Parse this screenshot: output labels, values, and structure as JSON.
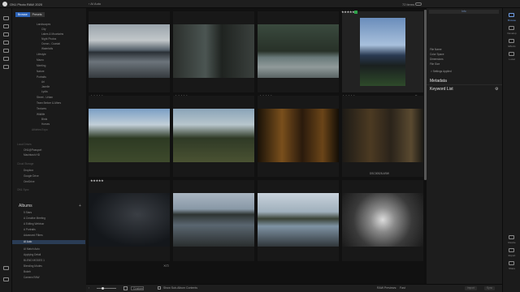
{
  "app": {
    "title": "ON1 Photo RAW 2020",
    "back_label": "AI Auto",
    "item_count": "72 items"
  },
  "sidebar": {
    "tabs": [
      {
        "label": "Browse"
      },
      {
        "label": "Presets"
      }
    ],
    "tree": [
      {
        "label": "Landscapes"
      },
      {
        "label": "City"
      },
      {
        "label": "Lakes & Mountains"
      },
      {
        "label": "Night Photos"
      },
      {
        "label": "Ocean - Coastal"
      },
      {
        "label": "Waterfalls"
      },
      {
        "label": "Lifestyle"
      },
      {
        "label": "Macro"
      },
      {
        "label": "Meeting"
      },
      {
        "label": "Nature"
      },
      {
        "label": "Portraits"
      },
      {
        "label": "Ari"
      },
      {
        "label": "Janelle"
      },
      {
        "label": "Lydia"
      },
      {
        "label": "Street - Urban"
      },
      {
        "label": "Team Before & Afters"
      },
      {
        "label": "Textures"
      },
      {
        "label": "Wildlife"
      },
      {
        "label": "Birds"
      },
      {
        "label": "Horses"
      },
      {
        "label": "Athletes Expo"
      }
    ],
    "local_drives": {
      "label": "Local Drives",
      "items": [
        {
          "label": "ON1@Passport"
        },
        {
          "label": "Macintosh HD"
        }
      ]
    },
    "cloud_storage": {
      "label": "Cloud Storage",
      "items": [
        {
          "label": "Dropbox"
        },
        {
          "label": "Google Drive"
        },
        {
          "label": "OneDrive"
        }
      ]
    },
    "on1_sync": {
      "label": "ON1 Sync"
    },
    "albums": {
      "title": "Albums",
      "add": "+",
      "items": [
        {
          "label": "5 Stars"
        },
        {
          "label": "A Creative Meeting"
        },
        {
          "label": "A Editing Webinar"
        },
        {
          "label": "A Portraits"
        },
        {
          "label": "Advanced Filters"
        },
        {
          "label": "AI Auto"
        },
        {
          "label": "AI Match Auto"
        },
        {
          "label": "Applying Detail"
        },
        {
          "label": "BLEND MODES 1"
        },
        {
          "label": "Blending Modes"
        },
        {
          "label": "Bokeh"
        },
        {
          "label": "Camera RAW"
        }
      ]
    }
  },
  "grid": {
    "cells": [
      {
        "stars": "★★★★★",
        "filename": "",
        "badge": false
      },
      {
        "stars": "★★★★★",
        "filename": "",
        "badge": false
      },
      {
        "stars": "★★★★★",
        "filename": "",
        "badge": false
      },
      {
        "stars": "★★★★★",
        "filename": "",
        "badge": true
      },
      {
        "stars": "★★★★★",
        "filename": "",
        "badge": false
      },
      {
        "stars": "",
        "filename": "",
        "badge": false
      },
      {
        "stars": "",
        "filename": "",
        "badge": false
      },
      {
        "stars": "",
        "filename": "DSC00528.ARW",
        "badge": false
      },
      {
        "stars": "★★★★★",
        "filename": "",
        "badge": false
      },
      {
        "stars": "",
        "filename": "",
        "badge": false
      },
      {
        "stars": "",
        "filename": "",
        "badge": false
      },
      {
        "stars": "",
        "filename": "",
        "badge": false
      }
    ]
  },
  "info_panel": {
    "header_tab": "Info",
    "fields": [
      {
        "label": "File Name"
      },
      {
        "label": "Color Space"
      },
      {
        "label": "Dimensions"
      },
      {
        "label": "File Size"
      }
    ],
    "settings_applied": "> Settings Applied",
    "metadata_title": "Metadata",
    "keyword_list_title": "Keyword List"
  },
  "right_strip": {
    "items": [
      {
        "label": "Browse"
      },
      {
        "label": "Develop"
      },
      {
        "label": "Effects"
      },
      {
        "label": "Local"
      },
      {
        "label": "Resize"
      },
      {
        "label": "Export"
      },
      {
        "label": "Share"
      }
    ]
  },
  "footer": {
    "sort_label": "Custom",
    "show_subalbum": "Show Sub-Album Contents",
    "preview_label": "RAW Previews:",
    "preview_value": "Fast",
    "buttons": [
      {
        "label": "Import"
      },
      {
        "label": "Sync"
      }
    ]
  }
}
